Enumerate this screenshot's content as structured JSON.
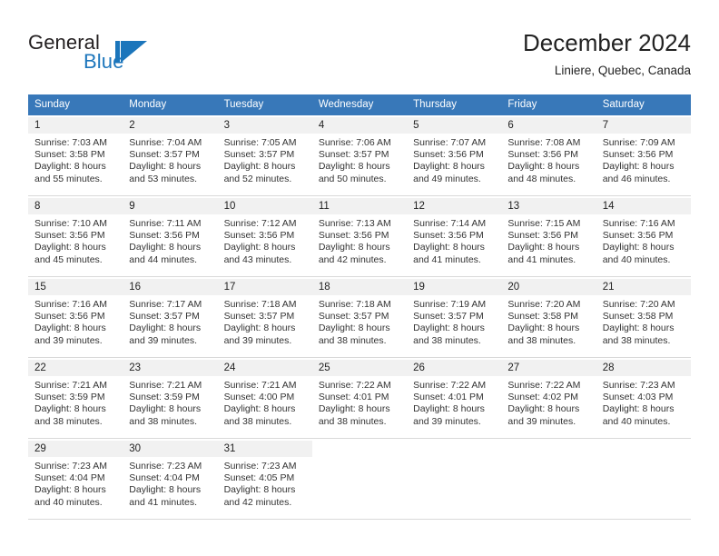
{
  "brand": {
    "name_part1": "General",
    "name_part2": "Blue",
    "logo_icon": "triangle-flag-icon",
    "accent_color": "#1b75bb"
  },
  "header": {
    "month_title": "December 2024",
    "location": "Liniere, Quebec, Canada"
  },
  "calendar": {
    "header_color": "#3878b9",
    "weekday_headers": [
      "Sunday",
      "Monday",
      "Tuesday",
      "Wednesday",
      "Thursday",
      "Friday",
      "Saturday"
    ],
    "weeks": [
      [
        {
          "day": "1",
          "sunrise": "Sunrise: 7:03 AM",
          "sunset": "Sunset: 3:58 PM",
          "daylight_line1": "Daylight: 8 hours",
          "daylight_line2": "and 55 minutes."
        },
        {
          "day": "2",
          "sunrise": "Sunrise: 7:04 AM",
          "sunset": "Sunset: 3:57 PM",
          "daylight_line1": "Daylight: 8 hours",
          "daylight_line2": "and 53 minutes."
        },
        {
          "day": "3",
          "sunrise": "Sunrise: 7:05 AM",
          "sunset": "Sunset: 3:57 PM",
          "daylight_line1": "Daylight: 8 hours",
          "daylight_line2": "and 52 minutes."
        },
        {
          "day": "4",
          "sunrise": "Sunrise: 7:06 AM",
          "sunset": "Sunset: 3:57 PM",
          "daylight_line1": "Daylight: 8 hours",
          "daylight_line2": "and 50 minutes."
        },
        {
          "day": "5",
          "sunrise": "Sunrise: 7:07 AM",
          "sunset": "Sunset: 3:56 PM",
          "daylight_line1": "Daylight: 8 hours",
          "daylight_line2": "and 49 minutes."
        },
        {
          "day": "6",
          "sunrise": "Sunrise: 7:08 AM",
          "sunset": "Sunset: 3:56 PM",
          "daylight_line1": "Daylight: 8 hours",
          "daylight_line2": "and 48 minutes."
        },
        {
          "day": "7",
          "sunrise": "Sunrise: 7:09 AM",
          "sunset": "Sunset: 3:56 PM",
          "daylight_line1": "Daylight: 8 hours",
          "daylight_line2": "and 46 minutes."
        }
      ],
      [
        {
          "day": "8",
          "sunrise": "Sunrise: 7:10 AM",
          "sunset": "Sunset: 3:56 PM",
          "daylight_line1": "Daylight: 8 hours",
          "daylight_line2": "and 45 minutes."
        },
        {
          "day": "9",
          "sunrise": "Sunrise: 7:11 AM",
          "sunset": "Sunset: 3:56 PM",
          "daylight_line1": "Daylight: 8 hours",
          "daylight_line2": "and 44 minutes."
        },
        {
          "day": "10",
          "sunrise": "Sunrise: 7:12 AM",
          "sunset": "Sunset: 3:56 PM",
          "daylight_line1": "Daylight: 8 hours",
          "daylight_line2": "and 43 minutes."
        },
        {
          "day": "11",
          "sunrise": "Sunrise: 7:13 AM",
          "sunset": "Sunset: 3:56 PM",
          "daylight_line1": "Daylight: 8 hours",
          "daylight_line2": "and 42 minutes."
        },
        {
          "day": "12",
          "sunrise": "Sunrise: 7:14 AM",
          "sunset": "Sunset: 3:56 PM",
          "daylight_line1": "Daylight: 8 hours",
          "daylight_line2": "and 41 minutes."
        },
        {
          "day": "13",
          "sunrise": "Sunrise: 7:15 AM",
          "sunset": "Sunset: 3:56 PM",
          "daylight_line1": "Daylight: 8 hours",
          "daylight_line2": "and 41 minutes."
        },
        {
          "day": "14",
          "sunrise": "Sunrise: 7:16 AM",
          "sunset": "Sunset: 3:56 PM",
          "daylight_line1": "Daylight: 8 hours",
          "daylight_line2": "and 40 minutes."
        }
      ],
      [
        {
          "day": "15",
          "sunrise": "Sunrise: 7:16 AM",
          "sunset": "Sunset: 3:56 PM",
          "daylight_line1": "Daylight: 8 hours",
          "daylight_line2": "and 39 minutes."
        },
        {
          "day": "16",
          "sunrise": "Sunrise: 7:17 AM",
          "sunset": "Sunset: 3:57 PM",
          "daylight_line1": "Daylight: 8 hours",
          "daylight_line2": "and 39 minutes."
        },
        {
          "day": "17",
          "sunrise": "Sunrise: 7:18 AM",
          "sunset": "Sunset: 3:57 PM",
          "daylight_line1": "Daylight: 8 hours",
          "daylight_line2": "and 39 minutes."
        },
        {
          "day": "18",
          "sunrise": "Sunrise: 7:18 AM",
          "sunset": "Sunset: 3:57 PM",
          "daylight_line1": "Daylight: 8 hours",
          "daylight_line2": "and 38 minutes."
        },
        {
          "day": "19",
          "sunrise": "Sunrise: 7:19 AM",
          "sunset": "Sunset: 3:57 PM",
          "daylight_line1": "Daylight: 8 hours",
          "daylight_line2": "and 38 minutes."
        },
        {
          "day": "20",
          "sunrise": "Sunrise: 7:20 AM",
          "sunset": "Sunset: 3:58 PM",
          "daylight_line1": "Daylight: 8 hours",
          "daylight_line2": "and 38 minutes."
        },
        {
          "day": "21",
          "sunrise": "Sunrise: 7:20 AM",
          "sunset": "Sunset: 3:58 PM",
          "daylight_line1": "Daylight: 8 hours",
          "daylight_line2": "and 38 minutes."
        }
      ],
      [
        {
          "day": "22",
          "sunrise": "Sunrise: 7:21 AM",
          "sunset": "Sunset: 3:59 PM",
          "daylight_line1": "Daylight: 8 hours",
          "daylight_line2": "and 38 minutes."
        },
        {
          "day": "23",
          "sunrise": "Sunrise: 7:21 AM",
          "sunset": "Sunset: 3:59 PM",
          "daylight_line1": "Daylight: 8 hours",
          "daylight_line2": "and 38 minutes."
        },
        {
          "day": "24",
          "sunrise": "Sunrise: 7:21 AM",
          "sunset": "Sunset: 4:00 PM",
          "daylight_line1": "Daylight: 8 hours",
          "daylight_line2": "and 38 minutes."
        },
        {
          "day": "25",
          "sunrise": "Sunrise: 7:22 AM",
          "sunset": "Sunset: 4:01 PM",
          "daylight_line1": "Daylight: 8 hours",
          "daylight_line2": "and 38 minutes."
        },
        {
          "day": "26",
          "sunrise": "Sunrise: 7:22 AM",
          "sunset": "Sunset: 4:01 PM",
          "daylight_line1": "Daylight: 8 hours",
          "daylight_line2": "and 39 minutes."
        },
        {
          "day": "27",
          "sunrise": "Sunrise: 7:22 AM",
          "sunset": "Sunset: 4:02 PM",
          "daylight_line1": "Daylight: 8 hours",
          "daylight_line2": "and 39 minutes."
        },
        {
          "day": "28",
          "sunrise": "Sunrise: 7:23 AM",
          "sunset": "Sunset: 4:03 PM",
          "daylight_line1": "Daylight: 8 hours",
          "daylight_line2": "and 40 minutes."
        }
      ],
      [
        {
          "day": "29",
          "sunrise": "Sunrise: 7:23 AM",
          "sunset": "Sunset: 4:04 PM",
          "daylight_line1": "Daylight: 8 hours",
          "daylight_line2": "and 40 minutes."
        },
        {
          "day": "30",
          "sunrise": "Sunrise: 7:23 AM",
          "sunset": "Sunset: 4:04 PM",
          "daylight_line1": "Daylight: 8 hours",
          "daylight_line2": "and 41 minutes."
        },
        {
          "day": "31",
          "sunrise": "Sunrise: 7:23 AM",
          "sunset": "Sunset: 4:05 PM",
          "daylight_line1": "Daylight: 8 hours",
          "daylight_line2": "and 42 minutes."
        },
        {
          "day": "",
          "sunrise": "",
          "sunset": "",
          "daylight_line1": "",
          "daylight_line2": ""
        },
        {
          "day": "",
          "sunrise": "",
          "sunset": "",
          "daylight_line1": "",
          "daylight_line2": ""
        },
        {
          "day": "",
          "sunrise": "",
          "sunset": "",
          "daylight_line1": "",
          "daylight_line2": ""
        },
        {
          "day": "",
          "sunrise": "",
          "sunset": "",
          "daylight_line1": "",
          "daylight_line2": ""
        }
      ]
    ]
  }
}
